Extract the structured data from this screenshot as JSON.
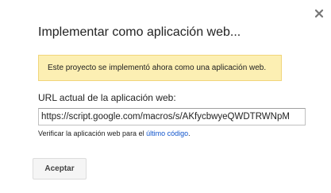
{
  "dialog": {
    "close_icon": "close-icon",
    "title": "Implementar como aplicación web...",
    "notice": "Este proyecto se implementó ahora como una aplicación web.",
    "url_label": "URL actual de la aplicación web:",
    "url_value": "https://script.google.com/macros/s/AKfycbwyeQWDTRWNpM",
    "verify_prefix": "Verificar la aplicación web para el ",
    "verify_link": "último código",
    "verify_suffix": ".",
    "accept_label": "Aceptar"
  },
  "colors": {
    "notice_bg": "#fcefb3",
    "notice_border": "#f1d57a",
    "link": "#1155cc",
    "button_bg": "#f5f5f5"
  }
}
